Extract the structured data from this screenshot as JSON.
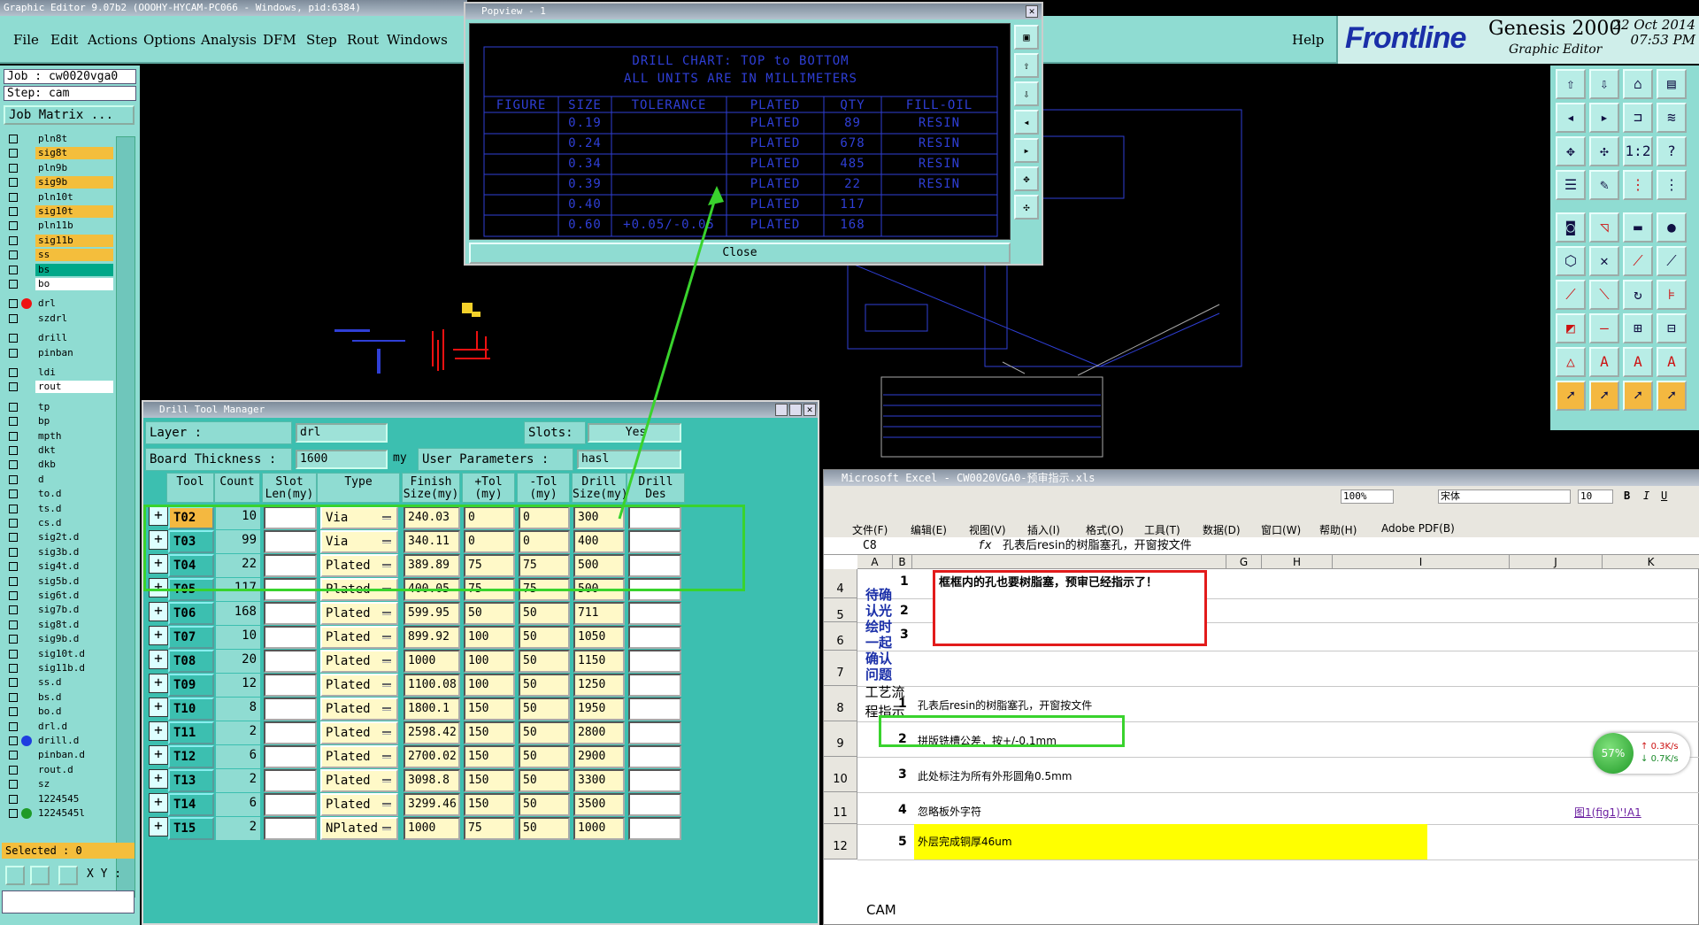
{
  "window_title": "Graphic Editor 9.07b2 (OOOHY-HYCAM-PC066 - Windows, pid:6384)",
  "menu": [
    "File",
    "Edit",
    "Actions",
    "Options",
    "Analysis",
    "DFM",
    "Step",
    "Rout",
    "Windows"
  ],
  "help": "Help",
  "brand": {
    "logo": "Frontline",
    "product": "Genesis 2000",
    "subtitle": "Graphic Editor",
    "date": "22 Oct 2014",
    "time": "07:53 PM"
  },
  "job": {
    "job_line": "Job : cw0020vga0",
    "step_line": "Step: cam",
    "matrix_btn": "Job Matrix ..."
  },
  "layers": [
    {
      "name": "pln8t",
      "color": "#8fdcd2"
    },
    {
      "name": "sig8t",
      "color": "#f4be3c"
    },
    {
      "name": "pln9b",
      "color": "#8fdcd2"
    },
    {
      "name": "sig9b",
      "color": "#f4be3c"
    },
    {
      "name": "pln10t",
      "color": "#8fdcd2"
    },
    {
      "name": "sig10t",
      "color": "#f4be3c"
    },
    {
      "name": "pln11b",
      "color": "#8fdcd2"
    },
    {
      "name": "sig11b",
      "color": "#f4be3c"
    },
    {
      "name": "ss",
      "color": "#f4be3c"
    },
    {
      "name": "bs",
      "color": "#00a889"
    },
    {
      "name": "bo",
      "color": "#ffffff"
    },
    {
      "name": "drl",
      "color": "#8fdcd2"
    },
    {
      "name": "szdrl",
      "color": "#8fdcd2"
    },
    {
      "name": "drill",
      "color": "#8fdcd2"
    },
    {
      "name": "pinban",
      "color": "#8fdcd2"
    },
    {
      "name": "ldi",
      "color": "#8fdcd2"
    },
    {
      "name": "rout",
      "color": "#ffffff"
    },
    {
      "name": "tp",
      "color": "#8fdcd2"
    },
    {
      "name": "bp",
      "color": "#8fdcd2"
    },
    {
      "name": "mpth",
      "color": "#8fdcd2"
    },
    {
      "name": "dkt",
      "color": "#8fdcd2"
    },
    {
      "name": "dkb",
      "color": "#8fdcd2"
    },
    {
      "name": "d",
      "color": "#8fdcd2"
    },
    {
      "name": "to.d",
      "color": "#8fdcd2"
    },
    {
      "name": "ts.d",
      "color": "#8fdcd2"
    },
    {
      "name": "cs.d",
      "color": "#8fdcd2"
    },
    {
      "name": "sig2t.d",
      "color": "#8fdcd2"
    },
    {
      "name": "sig3b.d",
      "color": "#8fdcd2"
    },
    {
      "name": "sig4t.d",
      "color": "#8fdcd2"
    },
    {
      "name": "sig5b.d",
      "color": "#8fdcd2"
    },
    {
      "name": "sig6t.d",
      "color": "#8fdcd2"
    },
    {
      "name": "sig7b.d",
      "color": "#8fdcd2"
    },
    {
      "name": "sig8t.d",
      "color": "#8fdcd2"
    },
    {
      "name": "sig9b.d",
      "color": "#8fdcd2"
    },
    {
      "name": "sig10t.d",
      "color": "#8fdcd2"
    },
    {
      "name": "sig11b.d",
      "color": "#8fdcd2"
    },
    {
      "name": "ss.d",
      "color": "#8fdcd2"
    },
    {
      "name": "bs.d",
      "color": "#8fdcd2"
    },
    {
      "name": "bo.d",
      "color": "#8fdcd2"
    },
    {
      "name": "drl.d",
      "color": "#8fdcd2"
    },
    {
      "name": "drill.d",
      "color": "#8fdcd2"
    },
    {
      "name": "pinban.d",
      "color": "#8fdcd2"
    },
    {
      "name": "rout.d",
      "color": "#8fdcd2"
    },
    {
      "name": "sz",
      "color": "#8fdcd2"
    },
    {
      "name": "1224545",
      "color": "#8fdcd2"
    },
    {
      "name": "1224545l",
      "color": "#8fdcd2"
    }
  ],
  "selected": "Selected : 0",
  "xy_label": "X Y :",
  "popview": {
    "title": "Popview - 1",
    "close": "Close",
    "chart_title": "DRILL CHART: TOP to BOTTOM",
    "chart_units": "ALL UNITS ARE IN MILLIMETERS",
    "headers": [
      "FIGURE",
      "SIZE",
      "TOLERANCE",
      "PLATED",
      "QTY",
      "FILL-OIL"
    ],
    "rows": [
      [
        "",
        "0.19",
        "",
        "PLATED",
        "89",
        "RESIN"
      ],
      [
        "",
        "0.24",
        "",
        "PLATED",
        "678",
        "RESIN"
      ],
      [
        "",
        "0.34",
        "",
        "PLATED",
        "485",
        "RESIN"
      ],
      [
        "",
        "0.39",
        "",
        "PLATED",
        "22",
        "RESIN"
      ],
      [
        "",
        "0.40",
        "",
        "PLATED",
        "117",
        ""
      ],
      [
        "",
        "0.60",
        "+0.05/-0.05",
        "PLATED",
        "168",
        ""
      ]
    ]
  },
  "dtm": {
    "title": "Drill Tool Manager",
    "layer_label": "Layer :",
    "layer_value": "drl",
    "slots_label": "Slots:",
    "slots_value": "Yes",
    "thick_label": "Board Thickness :",
    "thick_value": "1600",
    "thick_unit": "my",
    "user_label": "User Parameters :",
    "user_value": "hasl",
    "headers": [
      "Tool",
      "Count",
      "Slot\nLen(my)",
      "Type",
      "Finish\nSize(my)",
      "+Tol\n(my)",
      "-Tol\n(my)",
      "Drill\nSize(my)",
      "Drill\nDes"
    ],
    "rows": [
      {
        "tool": "T02",
        "count": "10",
        "type": "Via",
        "finish": "240.03",
        "ptol": "0",
        "ntol": "0",
        "drill": "300"
      },
      {
        "tool": "T03",
        "count": "99",
        "type": "Via",
        "finish": "340.11",
        "ptol": "0",
        "ntol": "0",
        "drill": "400"
      },
      {
        "tool": "T04",
        "count": "22",
        "type": "Plated",
        "finish": "389.89",
        "ptol": "75",
        "ntol": "75",
        "drill": "500"
      },
      {
        "tool": "T05",
        "count": "117",
        "type": "Plated",
        "finish": "400.05",
        "ptol": "75",
        "ntol": "75",
        "drill": "500"
      },
      {
        "tool": "T06",
        "count": "168",
        "type": "Plated",
        "finish": "599.95",
        "ptol": "50",
        "ntol": "50",
        "drill": "711"
      },
      {
        "tool": "T07",
        "count": "10",
        "type": "Plated",
        "finish": "899.92",
        "ptol": "100",
        "ntol": "50",
        "drill": "1050"
      },
      {
        "tool": "T08",
        "count": "20",
        "type": "Plated",
        "finish": "1000",
        "ptol": "100",
        "ntol": "50",
        "drill": "1150"
      },
      {
        "tool": "T09",
        "count": "12",
        "type": "Plated",
        "finish": "1100.08",
        "ptol": "100",
        "ntol": "50",
        "drill": "1250"
      },
      {
        "tool": "T10",
        "count": "8",
        "type": "Plated",
        "finish": "1800.1",
        "ptol": "150",
        "ntol": "50",
        "drill": "1950"
      },
      {
        "tool": "T11",
        "count": "2",
        "type": "Plated",
        "finish": "2598.42",
        "ptol": "150",
        "ntol": "50",
        "drill": "2800"
      },
      {
        "tool": "T12",
        "count": "6",
        "type": "Plated",
        "finish": "2700.02",
        "ptol": "150",
        "ntol": "50",
        "drill": "2900"
      },
      {
        "tool": "T13",
        "count": "2",
        "type": "Plated",
        "finish": "3098.8",
        "ptol": "150",
        "ntol": "50",
        "drill": "3300"
      },
      {
        "tool": "T14",
        "count": "6",
        "type": "Plated",
        "finish": "3299.46",
        "ptol": "150",
        "ntol": "50",
        "drill": "3500"
      },
      {
        "tool": "T15",
        "count": "2",
        "type": "NPlated",
        "finish": "1000",
        "ptol": "75",
        "ntol": "50",
        "drill": "1000"
      }
    ]
  },
  "excel": {
    "title": "Microsoft Excel - CW0020VGA0-预审指示.xls",
    "menus": [
      "文件(F)",
      "编辑(E)",
      "视图(V)",
      "插入(I)",
      "格式(O)",
      "工具(T)",
      "数据(D)",
      "窗口(W)",
      "帮助(H)",
      "Adobe PDF(B)"
    ],
    "zoom": "100%",
    "font": "宋体",
    "size": "10",
    "cell_ref": "C8",
    "fx": "fx",
    "formula": "孔表后resin的树脂塞孔，开窗按文件",
    "columns": [
      "A",
      "B",
      "G",
      "H",
      "I",
      "J",
      "K"
    ],
    "rows": [
      "4",
      "5",
      "6",
      "7",
      "8",
      "9",
      "10",
      "11",
      "12"
    ],
    "a_label": "待确认光绘时一起确认问题",
    "note": "框框内的孔也要树脂塞，预审已经指示了！",
    "process_label": "工艺流程指示",
    "cam_label": "CAM",
    "items": [
      {
        "n": "1",
        "text": ""
      },
      {
        "n": "2",
        "text": ""
      },
      {
        "n": "3",
        "text": ""
      },
      {
        "n": "1",
        "text": "孔表后resin的树脂塞孔，开窗按文件"
      },
      {
        "n": "2",
        "text": "拼版铣槽公差，按+/-0.1mm"
      },
      {
        "n": "3",
        "text": "此处标注为所有外形圆角0.5mm"
      },
      {
        "n": "4",
        "text": "忽略板外字符"
      },
      {
        "n": "5",
        "text": "外层完成铜厚46um"
      }
    ],
    "link": "图1(fig1)'!A1"
  },
  "speed": {
    "percent": "57%",
    "up": "0.3K/s",
    "down": "0.7K/s"
  }
}
